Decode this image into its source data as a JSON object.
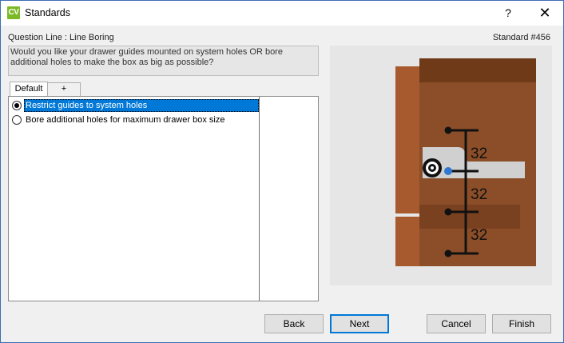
{
  "window": {
    "app_icon": "CV",
    "title": "Standards",
    "help_glyph": "?",
    "close_glyph": "✕"
  },
  "header": {
    "question_line": "Question Line : Line Boring",
    "standard_number": "Standard #456",
    "question_text": "Would you like your drawer guides mounted on system holes OR bore additional holes to make the box as big as possible?"
  },
  "tabs": [
    {
      "label": "Default",
      "selected": true
    },
    {
      "label": "+",
      "selected": false
    }
  ],
  "options": [
    {
      "label": "Restrict guides to system holes",
      "selected": true
    },
    {
      "label": "Bore additional holes for maximum drawer box size",
      "selected": false
    }
  ],
  "diagram": {
    "spacings": [
      "32",
      "32",
      "32"
    ],
    "colors": {
      "background": "#e6e6e6",
      "wood_main": "#8b4e28",
      "wood_edge": "#a65a2d",
      "wood_dark": "#6e3a18",
      "slide": "#d0d0d0",
      "ruler": "#111111",
      "dot": "#2e78d2"
    }
  },
  "buttons": {
    "back": "Back",
    "next": "Next",
    "cancel": "Cancel",
    "finish": "Finish"
  }
}
